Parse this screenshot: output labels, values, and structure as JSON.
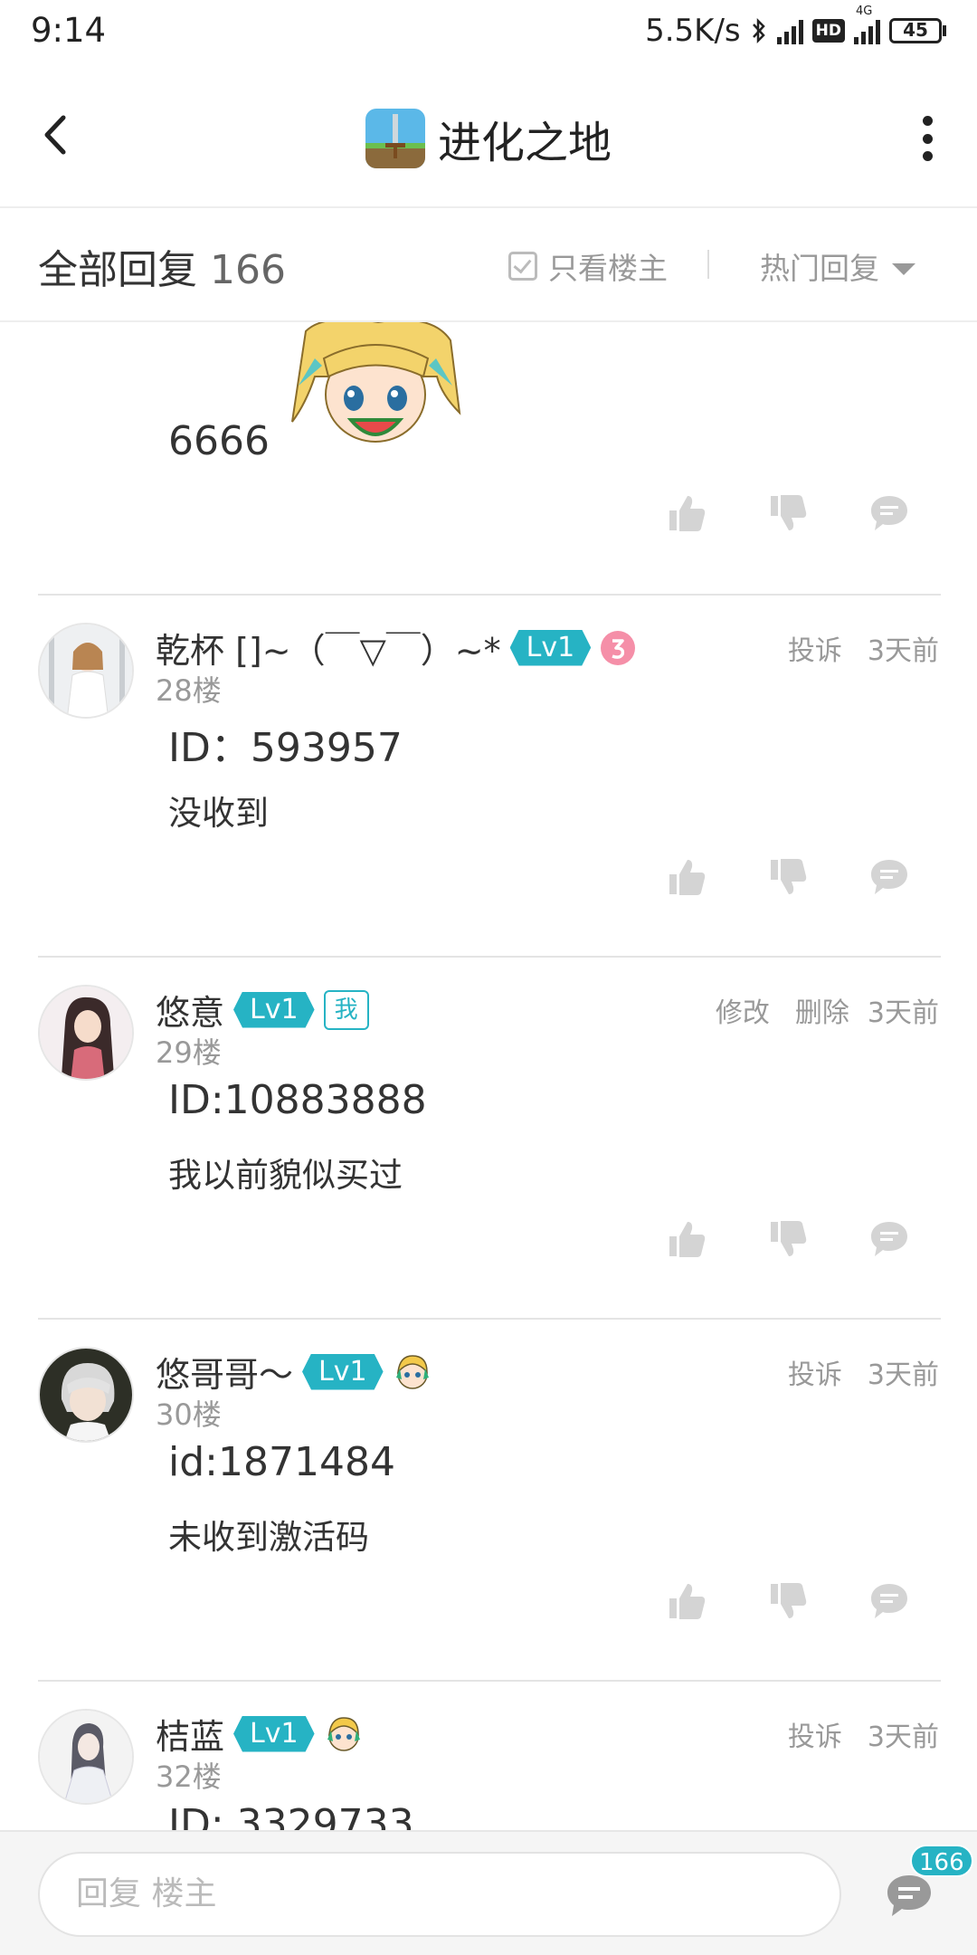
{
  "status_bar": {
    "time": "9:14",
    "net_speed": "5.5K/s",
    "network_type": "4G",
    "hd_label": "HD",
    "battery": "45",
    "battery_level": 0.45
  },
  "header": {
    "title": "进化之地"
  },
  "filter_bar": {
    "all_replies_label": "全部回复",
    "reply_count": "166",
    "owner_only_label": "只看楼主",
    "sort_label": "热门回复"
  },
  "partial_post": {
    "body": "6666"
  },
  "posts": [
    {
      "username": "乾杯 []~（￣▽￣）~*",
      "level": "Lv1",
      "floor": "28楼",
      "actions": [
        "投诉"
      ],
      "time": "3天前",
      "line1": "ID：593957",
      "line2": "没收到"
    },
    {
      "username": "悠意",
      "level": "Lv1",
      "me_badge": "我",
      "floor": "29楼",
      "actions": [
        "修改",
        "删除"
      ],
      "time": "3天前",
      "line1": "ID:10883888",
      "line2": "我以前貌似买过"
    },
    {
      "username": "悠哥哥～",
      "level": "Lv1",
      "floor": "30楼",
      "actions": [
        "投诉"
      ],
      "time": "3天前",
      "line1": "id:1871484",
      "line2": "未收到激活码"
    },
    {
      "username": "桔蓝",
      "level": "Lv1",
      "floor": "32楼",
      "actions": [
        "投诉"
      ],
      "time": "3天前",
      "line1": "ID: 3329733"
    }
  ],
  "bottom_bar": {
    "reply_placeholder": "回复  楼主",
    "comment_count": "166"
  },
  "colors": {
    "accent": "#26b3c4",
    "text": "#333333",
    "muted": "#999999"
  }
}
